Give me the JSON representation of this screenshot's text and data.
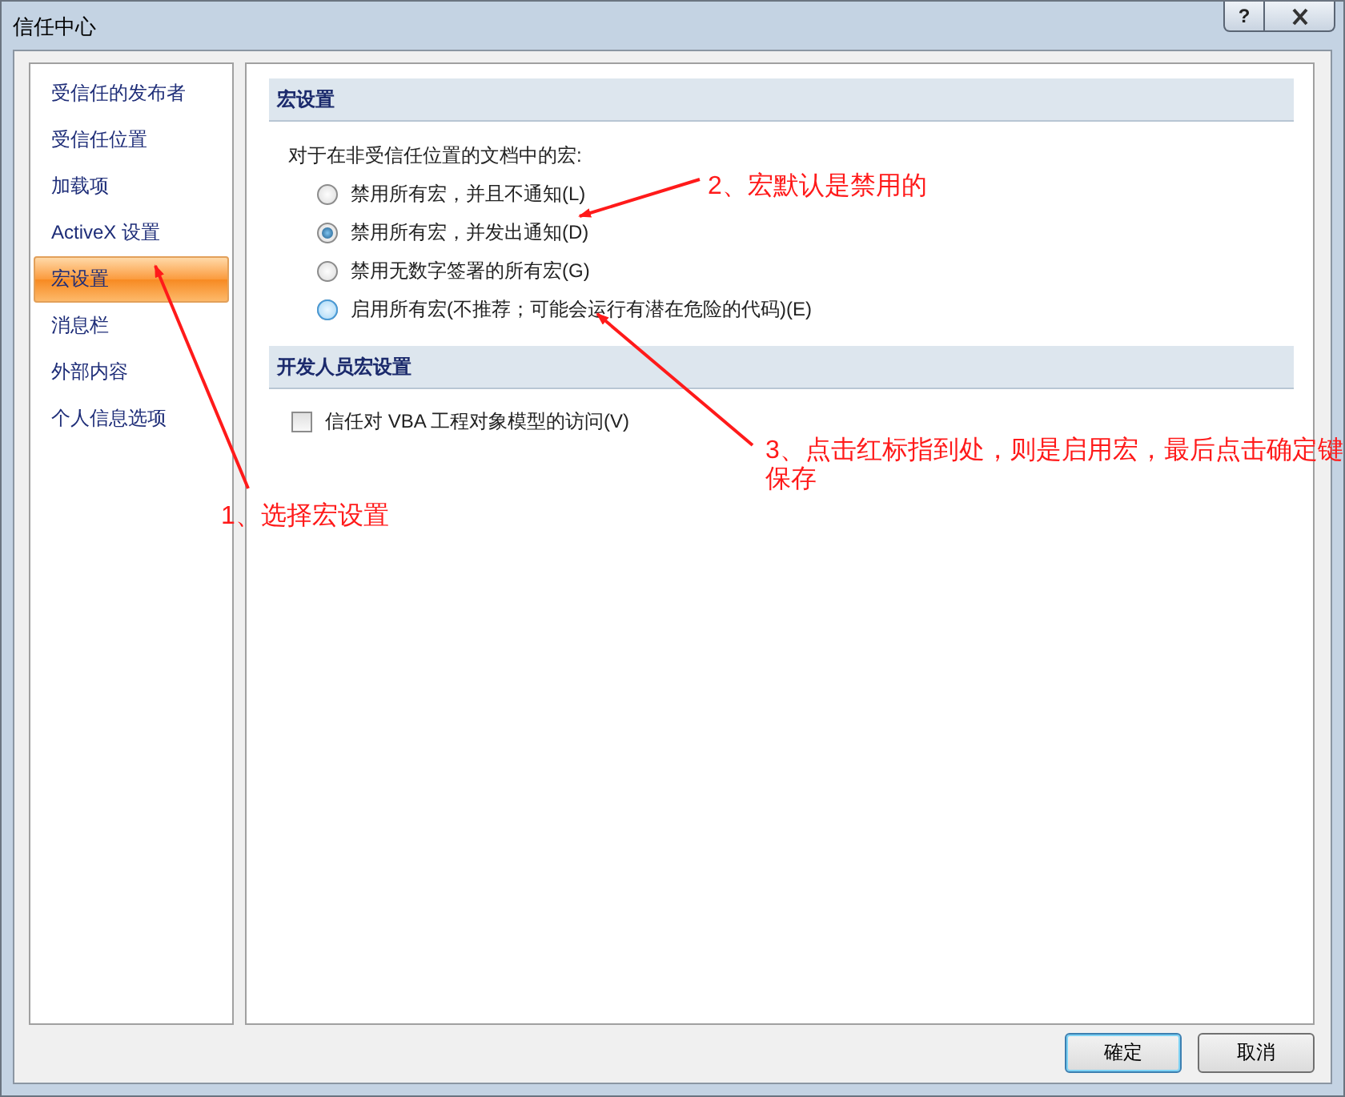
{
  "window": {
    "title": "信任中心",
    "help": "?"
  },
  "sidebar": {
    "items": [
      {
        "label": "受信任的发布者",
        "selected": false
      },
      {
        "label": "受信任位置",
        "selected": false
      },
      {
        "label": "加载项",
        "selected": false
      },
      {
        "label": "ActiveX 设置",
        "selected": false
      },
      {
        "label": "宏设置",
        "selected": true
      },
      {
        "label": "消息栏",
        "selected": false
      },
      {
        "label": "外部内容",
        "selected": false
      },
      {
        "label": "个人信息选项",
        "selected": false
      }
    ]
  },
  "sections": [
    {
      "title": "宏设置",
      "prompt": "对于在非受信任位置的文档中的宏:",
      "options": [
        {
          "label": "禁用所有宏，并且不通知(L)",
          "selected": false,
          "hovered": false
        },
        {
          "label": "禁用所有宏，并发出通知(D)",
          "selected": true,
          "hovered": false
        },
        {
          "label": "禁用无数字签署的所有宏(G)",
          "selected": false,
          "hovered": false
        },
        {
          "label": "启用所有宏(不推荐；可能会运行有潜在危险的代码)(E)",
          "selected": false,
          "hovered": true
        }
      ]
    },
    {
      "title": "开发人员宏设置",
      "checkbox": {
        "label": "信任对 VBA 工程对象模型的访问(V)",
        "checked": false
      }
    }
  ],
  "buttons": [
    {
      "label": "確定",
      "default": true
    },
    {
      "label": "取消",
      "default": false
    }
  ],
  "annotations": [
    {
      "lines": [
        "1、选择宏设置"
      ]
    },
    {
      "lines": [
        "2、宏默认是禁用的"
      ]
    },
    {
      "lines": [
        "3、点击红标指到处，则是启用宏，最后点击确定键",
        "保存"
      ]
    }
  ]
}
